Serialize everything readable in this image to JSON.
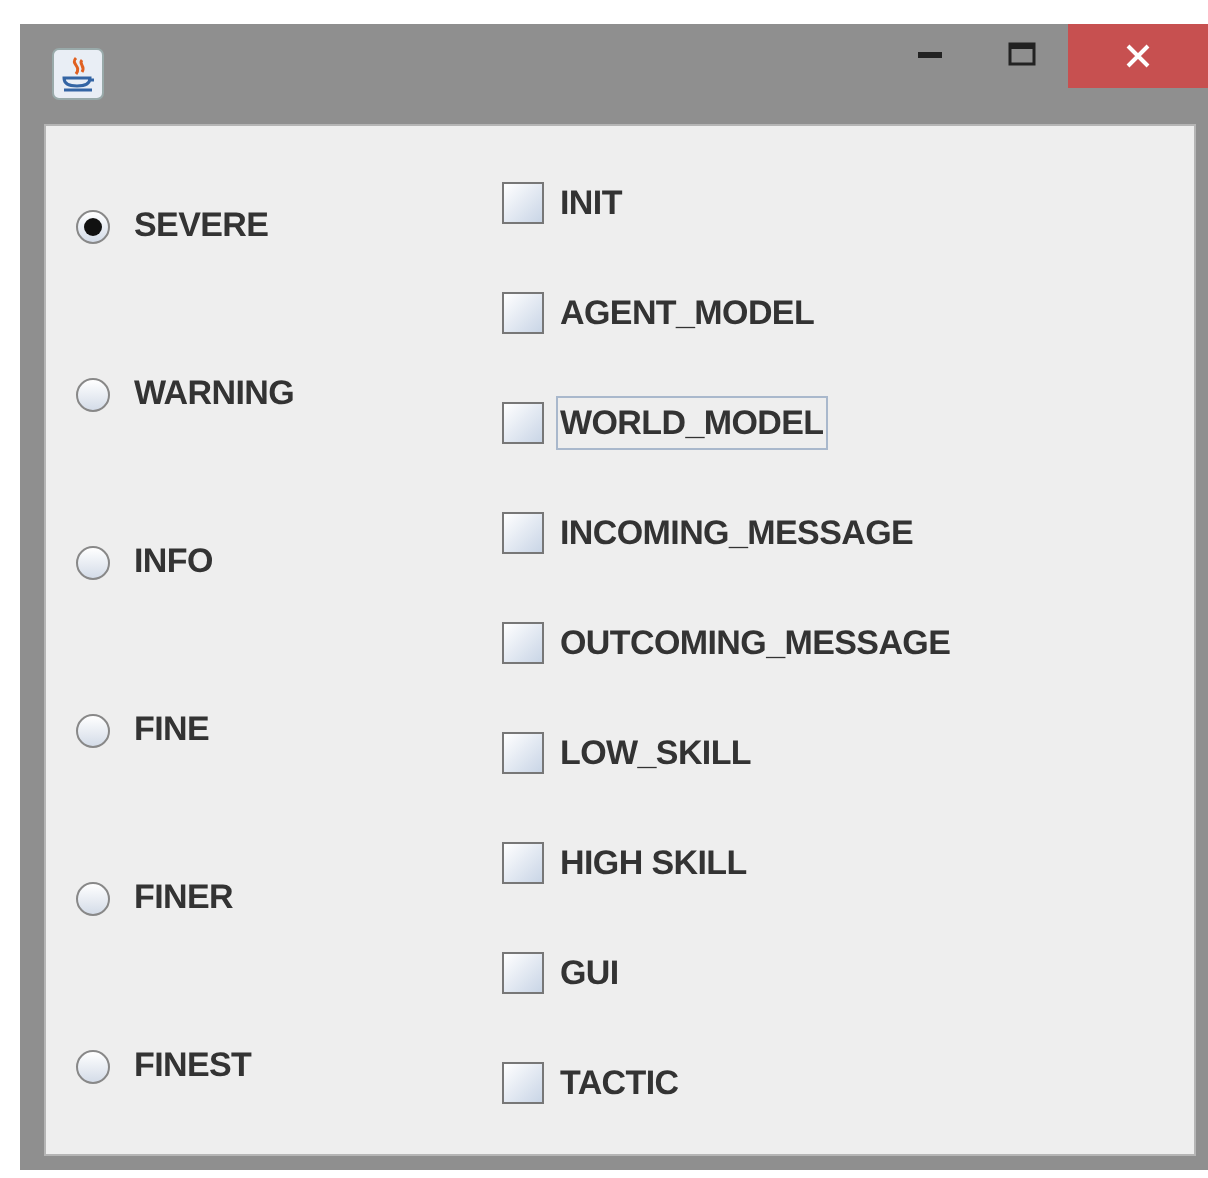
{
  "levels": [
    {
      "label": "SEVERE",
      "selected": true
    },
    {
      "label": "WARNING",
      "selected": false
    },
    {
      "label": "INFO",
      "selected": false
    },
    {
      "label": "FINE",
      "selected": false
    },
    {
      "label": "FINER",
      "selected": false
    },
    {
      "label": "FINEST",
      "selected": false
    }
  ],
  "categories": [
    {
      "label": "INIT",
      "checked": false,
      "focused": false
    },
    {
      "label": "AGENT_MODEL",
      "checked": false,
      "focused": false
    },
    {
      "label": "WORLD_MODEL",
      "checked": false,
      "focused": true
    },
    {
      "label": "INCOMING_MESSAGE",
      "checked": false,
      "focused": false
    },
    {
      "label": "OUTCOMING_MESSAGE",
      "checked": false,
      "focused": false
    },
    {
      "label": "LOW_SKILL",
      "checked": false,
      "focused": false
    },
    {
      "label": "HIGH SKILL",
      "checked": false,
      "focused": false
    },
    {
      "label": "GUI",
      "checked": false,
      "focused": false
    },
    {
      "label": "TACTIC",
      "checked": false,
      "focused": false
    }
  ]
}
